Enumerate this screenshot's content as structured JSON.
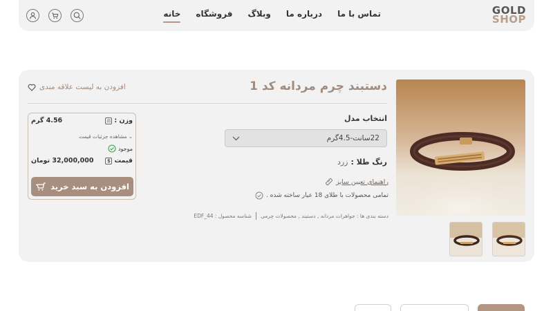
{
  "header": {
    "logo_line1": "GOLD",
    "logo_line2": "SHOP",
    "nav": [
      {
        "label": "خانه",
        "active": true
      },
      {
        "label": "فروشگاه",
        "active": false
      },
      {
        "label": "وبلاگ",
        "active": false
      },
      {
        "label": "درباره ما",
        "active": false
      },
      {
        "label": "تماس با ما",
        "active": false
      }
    ],
    "icons": [
      "search-icon",
      "cart-icon",
      "user-icon"
    ]
  },
  "product": {
    "title": "دستبند چرم مردانه کد 1",
    "wishlist_label": "افزودن به لیست علاقه مندی",
    "model_label": "انتخاب مدل",
    "model_value": "22سانت-4.5گرم",
    "color_label": "رنگ طلا :",
    "color_value": "زرد",
    "size_guide": "راهنمای تعیین سایز",
    "gold_note": "تمامی محصولات با طلای 18 عیار ساخته شده .",
    "categories": "دسته بندی ها : جواهرات مردانه , دستبند , محصولات چرمی",
    "sku": "شناسه محصول : EDF_44",
    "thumbnails_count": 2
  },
  "price_box": {
    "weight_label": "وزن :",
    "weight_value": "4.56 گرم",
    "details_link": "مشاهده جزئیات قیمت",
    "stock": "موجود",
    "price_label": "قیمت",
    "price_value": "32,000,000 تومان",
    "add_to_cart": "افزودن به سبد خرید"
  },
  "colors": {
    "accent": "#b39584",
    "title": "#a08b7c",
    "card_bg": "#f2f2f2",
    "stock_green": "#3aa84a"
  }
}
